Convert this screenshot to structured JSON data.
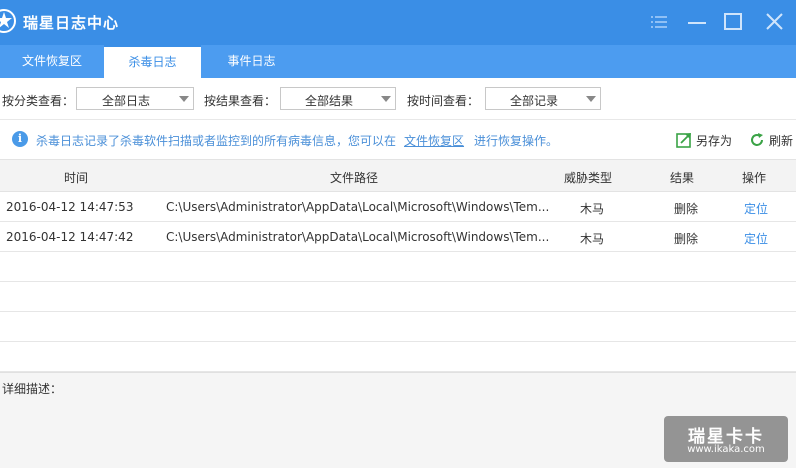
{
  "window": {
    "title": "瑞星日志中心",
    "controls": [
      "menu-icon",
      "minimize-icon",
      "maximize-icon",
      "close-icon"
    ]
  },
  "tabs": [
    {
      "label": "文件恢复区",
      "active": false
    },
    {
      "label": "杀毒日志",
      "active": true
    },
    {
      "label": "事件日志",
      "active": false
    }
  ],
  "filters": {
    "category_label": "按分类查看：",
    "category_value": "全部日志",
    "result_label": "按结果查看：",
    "result_value": "全部结果",
    "time_label": "按时间查看：",
    "time_value": "全部记录"
  },
  "info": {
    "icon": "i",
    "text": "杀毒日志记录了杀毒软件扫描或者监控到的所有病毒信息，您可以在",
    "link": "文件恢复区",
    "tail": "进行恢复操作。",
    "save_as_label": "另存为",
    "refresh_label": "刷新"
  },
  "table": {
    "headers": {
      "time": "时间",
      "path": "文件路径",
      "threat": "威胁类型",
      "result": "结果",
      "op": "操作"
    },
    "rows": [
      {
        "time": "2016-04-12 14:47:53",
        "path": "C:\\Users\\Administrator\\AppData\\Local\\Microsoft\\Windows\\Tem...",
        "threat": "木马",
        "result": "删除",
        "op": "定位"
      },
      {
        "time": "2016-04-12 14:47:42",
        "path": "C:\\Users\\Administrator\\AppData\\Local\\Microsoft\\Windows\\Tem...",
        "threat": "木马",
        "result": "删除",
        "op": "定位"
      }
    ]
  },
  "detail": {
    "label": "详细描述："
  },
  "watermark": {
    "title": "瑞星卡卡",
    "url": "www.ikaka.com"
  },
  "colors": {
    "titlebar": "#3a8ee6",
    "tabbar": "#4c9cf0",
    "link": "#4a8fd8"
  }
}
